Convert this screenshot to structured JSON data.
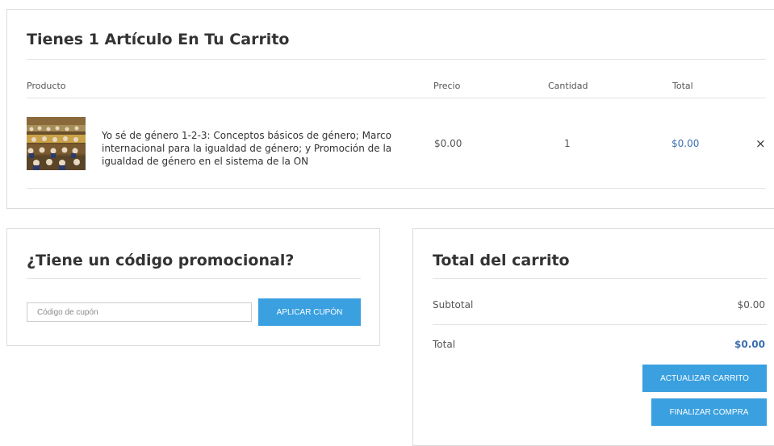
{
  "cart": {
    "title": "Tienes 1 Artículo En Tu Carrito",
    "columns": {
      "product": "Producto",
      "price": "Precio",
      "quantity": "Cantidad",
      "total": "Total"
    },
    "items": [
      {
        "name": "Yo sé de género 1-2-3: Conceptos básicos de género; Marco internacional para la igualdad de género; y Promoción de la igualdad de género en el sistema de la ON",
        "price": "$0.00",
        "quantity": "1",
        "total": "$0.00",
        "remove_icon": "×"
      }
    ]
  },
  "promo": {
    "title": "¿Tiene un código promocional?",
    "coupon_placeholder": "Código de cupón",
    "apply_label": "APLICAR CUPÓN"
  },
  "totals": {
    "title": "Total del carrito",
    "subtotal_label": "Subtotal",
    "subtotal_value": "$0.00",
    "total_label": "Total",
    "total_value": "$0.00",
    "update_label": "ACTUALIZAR CARRITO",
    "checkout_label": "FINALIZAR COMPRA"
  },
  "colors": {
    "accent": "#3aa0e0",
    "link_blue": "#3a6fb0",
    "border": "#dcdcdc"
  }
}
